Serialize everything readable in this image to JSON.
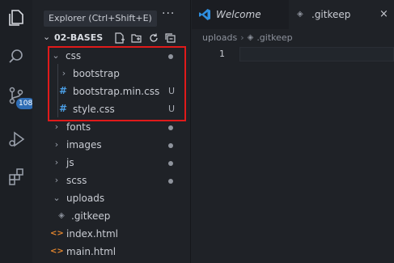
{
  "activity_bar": {
    "icons": [
      "explorer-icon",
      "search-icon",
      "source-control-icon",
      "run-debug-icon",
      "extensions-icon"
    ],
    "source_control_badge": "108"
  },
  "sidebar": {
    "title_tooltip": "Explorer (Ctrl+Shift+E)",
    "more_actions": "···",
    "project_name": "02-BASES",
    "project_actions": [
      "new-file-icon",
      "new-folder-icon",
      "refresh-icon",
      "collapse-all-icon"
    ],
    "tree": [
      {
        "label": "css",
        "kind": "folder",
        "expanded": true,
        "status": "dot"
      },
      {
        "label": "bootstrap",
        "kind": "folder",
        "expanded": false,
        "status": ""
      },
      {
        "label": "bootstrap.min.css",
        "kind": "css",
        "status": "U"
      },
      {
        "label": "style.css",
        "kind": "css",
        "status": "U"
      },
      {
        "label": "fonts",
        "kind": "folder",
        "expanded": false,
        "status": "dot"
      },
      {
        "label": "images",
        "kind": "folder",
        "expanded": false,
        "status": "dot"
      },
      {
        "label": "js",
        "kind": "folder",
        "expanded": false,
        "status": "dot"
      },
      {
        "label": "scss",
        "kind": "folder",
        "expanded": false,
        "status": "dot"
      },
      {
        "label": "uploads",
        "kind": "folder",
        "expanded": true,
        "status": ""
      },
      {
        "label": ".gitkeep",
        "kind": "gitkeep",
        "status": ""
      },
      {
        "label": "index.html",
        "kind": "html",
        "status": ""
      },
      {
        "label": "main.html",
        "kind": "html",
        "status": ""
      }
    ]
  },
  "tabs": [
    {
      "label": "Welcome",
      "active": false
    },
    {
      "label": ".gitkeep",
      "active": true,
      "close": "×"
    }
  ],
  "breadcrumb": {
    "folder": "uploads",
    "separator": "›",
    "file": ".gitkeep"
  },
  "editor": {
    "line_number": "1"
  },
  "colors": {
    "highlight_border": "#e01a1a",
    "css_icon": "#4b9fe6",
    "html_icon": "#e3862f",
    "badge": "#2f6db5",
    "vscode_blue": "#2f8fe0"
  }
}
